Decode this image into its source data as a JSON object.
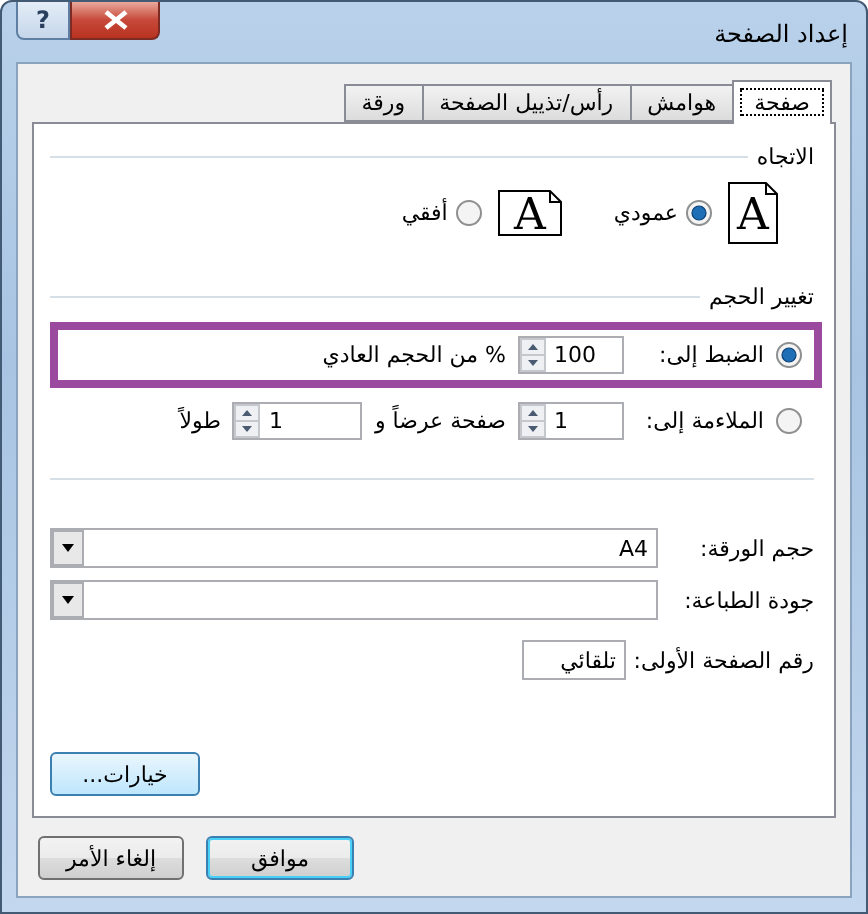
{
  "window": {
    "title": "إعداد الصفحة",
    "help_button": "?"
  },
  "tabs": [
    {
      "label": "صفحة",
      "selected": true
    },
    {
      "label": "هوامش",
      "selected": false
    },
    {
      "label": "رأس/تذييل الصفحة",
      "selected": false
    },
    {
      "label": "ورقة",
      "selected": false
    }
  ],
  "orientation": {
    "title": "الاتجاه",
    "options": [
      {
        "label": "عمودي",
        "selected": true,
        "kind": "portrait",
        "glyph": "A"
      },
      {
        "label": "أفقي",
        "selected": false,
        "kind": "landscape",
        "glyph": "A"
      }
    ]
  },
  "scaling": {
    "title": "تغيير الحجم",
    "adjust": {
      "label": "الضبط إلى:",
      "selected": true,
      "value": "100",
      "suffix": "% من الحجم العادي",
      "highlighted": true
    },
    "fit": {
      "label": "الملاءمة إلى:",
      "selected": false,
      "wide_value": "1",
      "wide_label": "صفحة عرضاً و",
      "tall_value": "1",
      "tall_label": "طولاً"
    }
  },
  "paper_size": {
    "label": "حجم الورقة:",
    "value": "A4"
  },
  "print_quality": {
    "label": "جودة الطباعة:"
  },
  "first_page_number": {
    "label": "رقم الصفحة الأولى:",
    "value": "تلقائي"
  },
  "options_button": "خيارات...",
  "buttons": {
    "ok": "موافق",
    "cancel": "إلغاء الأمر"
  }
}
